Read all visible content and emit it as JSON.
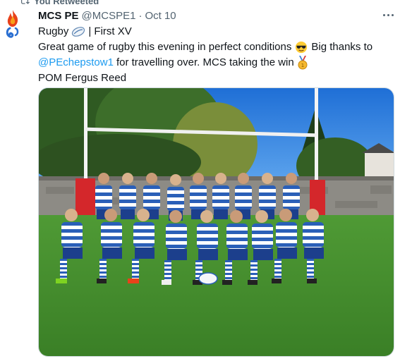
{
  "retweet": {
    "label": "You Retweeted"
  },
  "tweet": {
    "author_name": "MCS PE",
    "author_handle": "@MCSPE1",
    "separator": "·",
    "date": "Oct 10",
    "line1_prefix": "Rugby",
    "line1_suffix": "| First XV",
    "line2_text": "Great game of rugby this evening in perfect conditions",
    "line2_after": "Big thanks to",
    "mention": "@PEchepstow1",
    "line3_after": "for travelling over. MCS taking the win",
    "line4_text": "POM Fergus Reed"
  },
  "icons": {
    "retweet": "retweet-icon",
    "avatar": "flame-logo-icon",
    "rugby_ball": "rugby-ball-emoji",
    "sunglasses": "sunglasses-emoji",
    "medal": "medal-emoji",
    "more": "more-icon"
  },
  "colors": {
    "link": "#1d9bf0",
    "secondary_text": "#536471",
    "kit_blue": "#2a5fb8",
    "grass": "#3f8a2c",
    "sky": "#2f7ee0"
  }
}
